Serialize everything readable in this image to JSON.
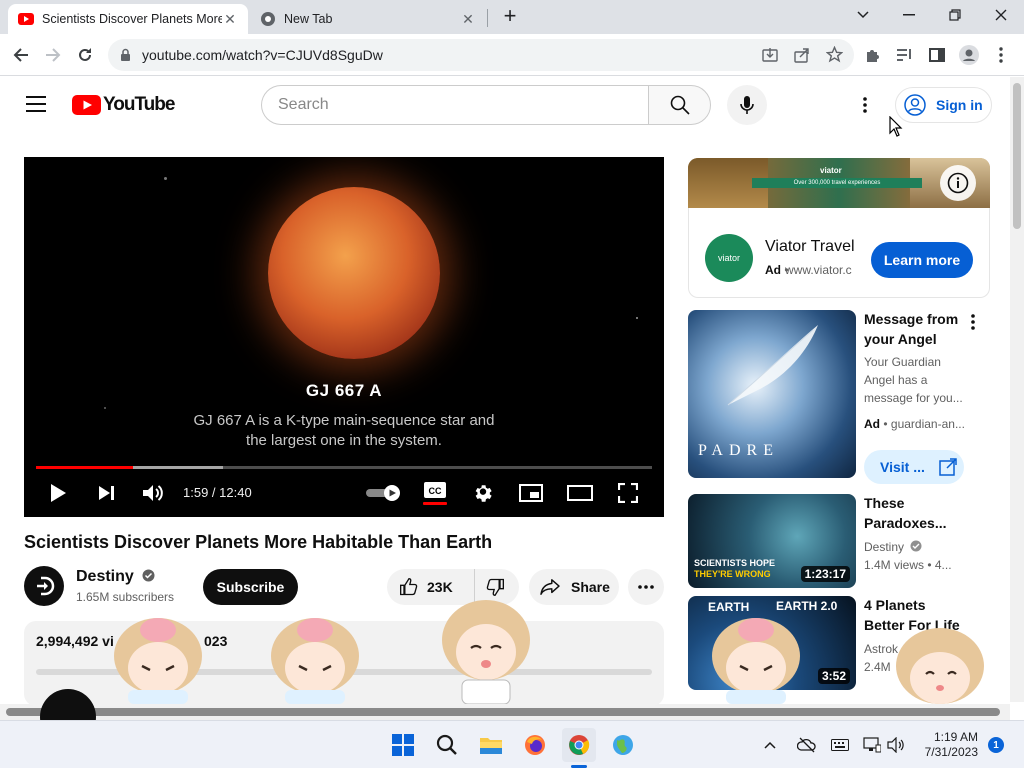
{
  "browser": {
    "tabs": [
      {
        "title": "Scientists Discover Planets More",
        "icon": "youtube-favicon",
        "active": true
      },
      {
        "title": "New Tab",
        "icon": "chrome-favicon",
        "active": false
      }
    ],
    "url": "youtube.com/watch?v=CJUVd8SguDw"
  },
  "youtube": {
    "logo_text": "YouTube",
    "search_placeholder": "Search",
    "signin_label": "Sign in"
  },
  "player": {
    "caption_title": "GJ 667 A",
    "caption_body": "GJ 667 A is a K-type main-sequence star and the largest one in the system.",
    "time": "1:59 / 12:40",
    "progress_played_fraction": 0.157,
    "progress_buffered_fraction": 0.303
  },
  "video": {
    "title": "Scientists Discover Planets More Habitable Than Earth",
    "channel_name": "Destiny",
    "subscribers": "1.65M subscribers",
    "subscribe_label": "Subscribe",
    "likes": "23K",
    "share_label": "Share",
    "views_date_left": "2,994,492 vi",
    "views_date_right": "023"
  },
  "ad": {
    "banner_brand": "viator",
    "banner_strip": "Over 300,000 travel experiences",
    "logo_text": "viator",
    "name": "Viator Travel",
    "badge": "Ad",
    "domain": "www.viator.c",
    "cta": "Learn more"
  },
  "recommendations": [
    {
      "title": "Message from your Angel",
      "meta_lines": [
        "Your Guardian Angel has a message for you..."
      ],
      "ad_badge": "Ad",
      "ad_domain": "guardian-an...",
      "cta": "Visit ...",
      "thumb_text": "PADRE"
    },
    {
      "title": "These Paradoxes...",
      "meta_lines": [
        "Destiny",
        "1.4M views  • 4..."
      ],
      "duration": "1:23:17",
      "thumb_text_1": "SCIENTISTS HOPE",
      "thumb_text_2": "THEY'RE WRONG"
    },
    {
      "title": "4 Planets Better For Life",
      "meta_lines": [
        "Astrok",
        "2.4M"
      ],
      "duration": "3:52",
      "thumb_text_1": "EARTH",
      "thumb_text_2": "EARTH 2.0"
    }
  ],
  "taskbar": {
    "time": "1:19 AM",
    "date": "7/31/2023",
    "notification_count": "1"
  },
  "colors": {
    "youtube_red": "#ff0000",
    "link_blue": "#065fd4",
    "viator_green": "#1b8a5a"
  }
}
